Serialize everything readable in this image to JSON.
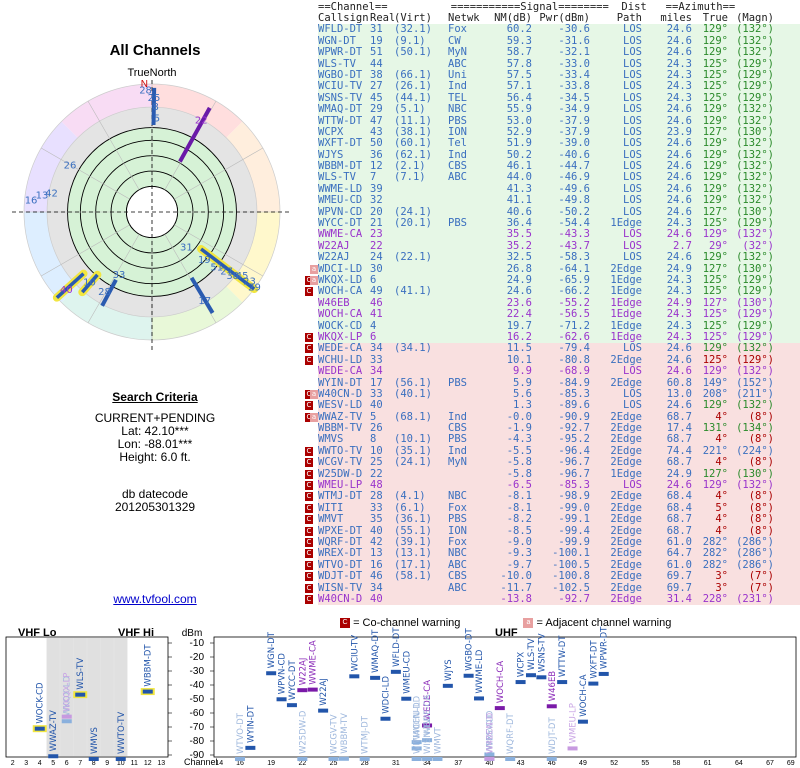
{
  "left": {
    "title": "All Channels",
    "true_north": "TrueNorth",
    "north_letter": "N",
    "criteria_title": "Search Criteria",
    "criteria": [
      "CURRENT+PENDING",
      "Lat: 42.10***",
      "Lon: -88.01***",
      "Height: 6.0 ft."
    ],
    "db": [
      "db datecode",
      "201205301329"
    ],
    "link": "www.tvfool.com"
  },
  "table": {
    "header1": "==Channel==          ===========Signal========  Dist   ==Azimuth==",
    "header2": [
      "Callsign",
      "Real",
      "(Virt)",
      "Netwk",
      "NM(dB)",
      "Pwr(dBm)",
      "Path",
      "miles",
      "True",
      "(Magn)"
    ],
    "rows": [
      [
        "WFLD-DT",
        "31",
        "(32.1)",
        "Fox",
        "60.2",
        "-30.6",
        "LOS",
        "24.6",
        "129°",
        "(132°)",
        "g",
        ""
      ],
      [
        "WGN-DT",
        "19",
        "(9.1)",
        "CW",
        "59.3",
        "-31.6",
        "LOS",
        "24.6",
        "129°",
        "(132°)",
        "g",
        ""
      ],
      [
        "WPWR-DT",
        "51",
        "(50.1)",
        "MyN",
        "58.7",
        "-32.1",
        "LOS",
        "24.6",
        "129°",
        "(132°)",
        "g",
        ""
      ],
      [
        "WLS-TV",
        "44",
        "",
        "ABC",
        "57.8",
        "-33.0",
        "LOS",
        "24.3",
        "125°",
        "(129°)",
        "g",
        ""
      ],
      [
        "WGBO-DT",
        "38",
        "(66.1)",
        "Uni",
        "57.5",
        "-33.4",
        "LOS",
        "24.3",
        "125°",
        "(129°)",
        "g",
        ""
      ],
      [
        "WCIU-TV",
        "27",
        "(26.1)",
        "Ind",
        "57.1",
        "-33.8",
        "LOS",
        "24.3",
        "125°",
        "(129°)",
        "g",
        ""
      ],
      [
        "WSNS-TV",
        "45",
        "(44.1)",
        "TEL",
        "56.4",
        "-34.5",
        "LOS",
        "24.3",
        "125°",
        "(129°)",
        "g",
        ""
      ],
      [
        "WMAQ-DT",
        "29",
        "(5.1)",
        "NBC",
        "55.9",
        "-34.9",
        "LOS",
        "24.6",
        "129°",
        "(132°)",
        "g",
        ""
      ],
      [
        "WTTW-DT",
        "47",
        "(11.1)",
        "PBS",
        "53.0",
        "-37.9",
        "LOS",
        "24.6",
        "129°",
        "(132°)",
        "g",
        ""
      ],
      [
        "WCPX",
        "43",
        "(38.1)",
        "ION",
        "52.9",
        "-37.9",
        "LOS",
        "23.9",
        "127°",
        "(130°)",
        "g",
        ""
      ],
      [
        "WXFT-DT",
        "50",
        "(60.1)",
        "Tel",
        "51.9",
        "-39.0",
        "LOS",
        "24.6",
        "129°",
        "(132°)",
        "g",
        ""
      ],
      [
        "WJYS",
        "36",
        "(62.1)",
        "Ind",
        "50.2",
        "-40.6",
        "LOS",
        "24.6",
        "129°",
        "(132°)",
        "g",
        ""
      ],
      [
        "WBBM-DT",
        "12",
        "(2.1)",
        "CBS",
        "46.1",
        "-44.7",
        "LOS",
        "24.6",
        "129°",
        "(132°)",
        "g",
        ""
      ],
      [
        "WLS-TV",
        "7",
        "(7.1)",
        "ABC",
        "44.0",
        "-46.9",
        "LOS",
        "24.6",
        "129°",
        "(132°)",
        "g",
        ""
      ],
      [
        "WWME-LD",
        "39",
        "",
        "",
        "41.3",
        "-49.6",
        "LOS",
        "24.6",
        "129°",
        "(132°)",
        "g",
        ""
      ],
      [
        "WMEU-CD",
        "32",
        "",
        "",
        "41.1",
        "-49.8",
        "LOS",
        "24.6",
        "129°",
        "(132°)",
        "g",
        ""
      ],
      [
        "WPVN-CD",
        "20",
        "(24.1)",
        "",
        "40.6",
        "-50.2",
        "LOS",
        "24.6",
        "127°",
        "(130°)",
        "g",
        ""
      ],
      [
        "WYCC-DT",
        "21",
        "(20.1)",
        "PBS",
        "36.4",
        "-54.4",
        "1Edge",
        "24.3",
        "125°",
        "(129°)",
        "g",
        ""
      ],
      [
        "WWME-CA",
        "23",
        "",
        "",
        "35.5",
        "-43.3",
        "LOS",
        "24.6",
        "129°",
        "(132°)",
        "p",
        ""
      ],
      [
        "W22AJ",
        "22",
        "",
        "",
        "35.2",
        "-43.7",
        "LOS",
        "2.7",
        "29°",
        "(32°)",
        "p",
        ""
      ],
      [
        "W22AJ",
        "24",
        "(22.1)",
        "",
        "32.5",
        "-58.3",
        "LOS",
        "24.6",
        "129°",
        "(132°)",
        "g",
        ""
      ],
      [
        "WDCI-LD",
        "30",
        "",
        "",
        "26.8",
        "-64.1",
        "2Edge",
        "24.9",
        "127°",
        "(130°)",
        "g",
        "a"
      ],
      [
        "WKQX-LD",
        "6",
        "",
        "",
        "24.9",
        "-65.9",
        "1Edge",
        "24.3",
        "125°",
        "(129°)",
        "g",
        "ac"
      ],
      [
        "WOCH-CA",
        "49",
        "(41.1)",
        "",
        "24.6",
        "-66.2",
        "1Edge",
        "24.3",
        "125°",
        "(129°)",
        "g",
        "c"
      ],
      [
        "W46EB",
        "46",
        "",
        "",
        "23.6",
        "-55.2",
        "1Edge",
        "24.9",
        "127°",
        "(130°)",
        "p",
        ""
      ],
      [
        "WOCH-CA",
        "41",
        "",
        "",
        "22.4",
        "-56.5",
        "1Edge",
        "24.3",
        "125°",
        "(129°)",
        "p",
        ""
      ],
      [
        "WOCK-CD",
        "4",
        "",
        "",
        "19.7",
        "-71.2",
        "1Edge",
        "24.3",
        "125°",
        "(129°)",
        "g",
        ""
      ],
      [
        "WKQX-LP",
        "6",
        "",
        "",
        "16.2",
        "-62.6",
        "1Edge",
        "24.3",
        "125°",
        "(129°)",
        "p",
        "c"
      ],
      [
        "WEDE-CA",
        "34",
        "(34.1)",
        "",
        "11.5",
        "-79.4",
        "LOS",
        "24.6",
        "129°",
        "(132°)",
        "r",
        "c"
      ],
      [
        "WCHU-LD",
        "33",
        "",
        "",
        "10.1",
        "-80.8",
        "2Edge",
        "24.6",
        "125°",
        "(129°)",
        "r",
        "c"
      ],
      [
        "WEDE-CA",
        "34",
        "",
        "",
        "9.9",
        "-68.9",
        "LOS",
        "24.6",
        "129°",
        "(132°)",
        "rp",
        ""
      ],
      [
        "WYIN-DT",
        "17",
        "(56.1)",
        "PBS",
        "5.9",
        "-84.9",
        "2Edge",
        "60.8",
        "149°",
        "(152°)",
        "r",
        ""
      ],
      [
        "W40CN-D",
        "33",
        "(40.1)",
        "",
        "5.6",
        "-85.3",
        "LOS",
        "13.0",
        "208°",
        "(211°)",
        "r",
        "ac"
      ],
      [
        "WESV-LD",
        "40",
        "",
        "",
        "1.3",
        "-89.6",
        "LOS",
        "24.6",
        "129°",
        "(132°)",
        "r",
        "c"
      ],
      [
        "WWAZ-TV",
        "5",
        "(68.1)",
        "Ind",
        "-0.0",
        "-90.9",
        "2Edge",
        "68.7",
        "4°",
        "(8°)",
        "r",
        "ac"
      ],
      [
        "WBBM-TV",
        "26",
        "",
        "CBS",
        "-1.9",
        "-92.7",
        "2Edge",
        "17.4",
        "131°",
        "(134°)",
        "r",
        ""
      ],
      [
        "WMVS",
        "8",
        "(10.1)",
        "PBS",
        "-4.3",
        "-95.2",
        "2Edge",
        "68.7",
        "4°",
        "(8°)",
        "r",
        ""
      ],
      [
        "WWTO-TV",
        "10",
        "(35.1)",
        "Ind",
        "-5.5",
        "-96.4",
        "2Edge",
        "74.4",
        "221°",
        "(224°)",
        "r",
        "c"
      ],
      [
        "WCGV-TV",
        "25",
        "(24.1)",
        "MyN",
        "-5.8",
        "-96.7",
        "2Edge",
        "68.7",
        "4°",
        "(8°)",
        "r",
        "c"
      ],
      [
        "W25DW-D",
        "22",
        "",
        "",
        "-5.8",
        "-96.7",
        "1Edge",
        "24.9",
        "127°",
        "(130°)",
        "r",
        "c"
      ],
      [
        "WMEU-LP",
        "48",
        "",
        "",
        "-6.5",
        "-85.3",
        "LOS",
        "24.6",
        "129°",
        "(132°)",
        "rp",
        "c"
      ],
      [
        "WTMJ-DT",
        "28",
        "(4.1)",
        "NBC",
        "-8.1",
        "-98.9",
        "2Edge",
        "68.4",
        "4°",
        "(8°)",
        "r",
        "c"
      ],
      [
        "WITI",
        "33",
        "(6.1)",
        "Fox",
        "-8.1",
        "-99.0",
        "2Edge",
        "68.4",
        "5°",
        "(8°)",
        "r",
        "c"
      ],
      [
        "WMVT",
        "35",
        "(36.1)",
        "PBS",
        "-8.2",
        "-99.1",
        "2Edge",
        "68.7",
        "4°",
        "(8°)",
        "r",
        "c"
      ],
      [
        "WPXE-DT",
        "40",
        "(55.1)",
        "ION",
        "-8.5",
        "-99.4",
        "2Edge",
        "68.7",
        "4°",
        "(8°)",
        "r",
        "c"
      ],
      [
        "WQRF-DT",
        "42",
        "(39.1)",
        "Fox",
        "-9.0",
        "-99.9",
        "2Edge",
        "61.0",
        "282°",
        "(286°)",
        "r",
        "c"
      ],
      [
        "WREX-DT",
        "13",
        "(13.1)",
        "NBC",
        "-9.3",
        "-100.1",
        "2Edge",
        "64.7",
        "282°",
        "(286°)",
        "r",
        "c"
      ],
      [
        "WTVO-DT",
        "16",
        "(17.1)",
        "ABC",
        "-9.7",
        "-100.5",
        "2Edge",
        "61.0",
        "282°",
        "(286°)",
        "r",
        "c"
      ],
      [
        "WDJT-DT",
        "46",
        "(58.1)",
        "CBS",
        "-10.0",
        "-100.8",
        "2Edge",
        "69.7",
        "3°",
        "(7°)",
        "r",
        "c"
      ],
      [
        "WISN-TV",
        "34",
        "",
        "ABC",
        "-11.7",
        "-102.5",
        "2Edge",
        "69.7",
        "3°",
        "(7°)",
        "r",
        "c"
      ],
      [
        "W40CN-D",
        "40",
        "",
        "",
        "-13.8",
        "-92.7",
        "2Edge",
        "31.4",
        "228°",
        "(231°)",
        "rp",
        "c"
      ]
    ]
  },
  "legend": {
    "cochannel": "= Co-channel warning",
    "adjacent": "= Adjacent channel warning",
    "c_letter": "C",
    "a_letter": "a"
  },
  "colors": {
    "green_row": "#e6f7e6",
    "red_row": "#f9e0e0",
    "blue_text": "#3a6fbf",
    "purple_text": "#9933cc",
    "dark_red": "#aa0000"
  },
  "chart_data": {
    "type": "scatter",
    "panels": [
      "VHF Lo",
      "VHF Hi",
      "UHF"
    ],
    "y_unit": "dBm",
    "ylim": [
      -90,
      -10
    ],
    "y_ticks": [
      -10,
      -20,
      -30,
      -40,
      -50,
      -60,
      -70,
      -80,
      -90
    ],
    "vhf_ticks": [
      "2",
      "3",
      "4",
      "5",
      "6",
      "7",
      "8",
      "9",
      "10",
      "11",
      "12",
      "13"
    ],
    "uhf_ticks": [
      "14",
      "16",
      "19",
      "22",
      "25",
      "28",
      "31",
      "34",
      "37",
      "40",
      "43",
      "46",
      "49",
      "52",
      "55",
      "58",
      "61",
      "64",
      "67",
      "69"
    ],
    "channel_axis_label": "Channel",
    "stations": [
      {
        "name": "WOCK-CD",
        "ch": 4,
        "dbm": -71.2,
        "c": "b"
      },
      {
        "name": "WWAZ-TV",
        "ch": 5,
        "dbm": -90.9,
        "c": "b"
      },
      {
        "name": "WKQX-LD",
        "ch": 6,
        "dbm": -65.9,
        "c": "lb"
      },
      {
        "name": "WKQX-LP",
        "ch": 6,
        "dbm": -62.6,
        "c": "lp"
      },
      {
        "name": "WLS-TV",
        "ch": 7,
        "dbm": -46.9,
        "c": "b"
      },
      {
        "name": "WMVS",
        "ch": 8,
        "dbm": -95.2,
        "c": "b"
      },
      {
        "name": "WWTO-TV",
        "ch": 10,
        "dbm": -96.4,
        "c": "b"
      },
      {
        "name": "WBBM-DT",
        "ch": 12,
        "dbm": -44.7,
        "c": "b"
      },
      {
        "name": "WTVO-DT",
        "ch": 16,
        "dbm": -100.5,
        "c": "lb"
      },
      {
        "name": "WYIN-DT",
        "ch": 17,
        "dbm": -84.9,
        "c": "b"
      },
      {
        "name": "WGN-DT",
        "ch": 19,
        "dbm": -31.6,
        "c": "b"
      },
      {
        "name": "WPVN-CD",
        "ch": 20,
        "dbm": -50.2,
        "c": "b"
      },
      {
        "name": "WYCC-DT",
        "ch": 21,
        "dbm": -54.4,
        "c": "b"
      },
      {
        "name": "W22AJ",
        "ch": 22,
        "dbm": -43.7,
        "c": "p"
      },
      {
        "name": "W25DW-D",
        "ch": 22,
        "dbm": -96.7,
        "c": "lb"
      },
      {
        "name": "WWME-CA",
        "ch": 23,
        "dbm": -43.3,
        "c": "p"
      },
      {
        "name": "W22AJ",
        "ch": 24,
        "dbm": -58.3,
        "c": "b"
      },
      {
        "name": "WCGV-TV",
        "ch": 25,
        "dbm": -96.7,
        "c": "lb"
      },
      {
        "name": "WBBM-TV",
        "ch": 26,
        "dbm": -92.7,
        "c": "lb"
      },
      {
        "name": "WCIU-TV",
        "ch": 27,
        "dbm": -33.8,
        "c": "b"
      },
      {
        "name": "WTMJ-DT",
        "ch": 28,
        "dbm": -98.9,
        "c": "lb"
      },
      {
        "name": "WMAQ-DT",
        "ch": 29,
        "dbm": -34.9,
        "c": "b"
      },
      {
        "name": "WDCI-LD",
        "ch": 30,
        "dbm": -64.1,
        "c": "b"
      },
      {
        "name": "WFLD-DT",
        "ch": 31,
        "dbm": -30.6,
        "c": "b"
      },
      {
        "name": "WMEU-CD",
        "ch": 32,
        "dbm": -49.8,
        "c": "b"
      },
      {
        "name": "WCHU-LD",
        "ch": 33,
        "dbm": -80.8,
        "c": "lb"
      },
      {
        "name": "W40CN-D",
        "ch": 33,
        "dbm": -85.3,
        "c": "lb"
      },
      {
        "name": "WITI",
        "ch": 33,
        "dbm": -99.0,
        "c": "lb"
      },
      {
        "name": "WEDE-CA",
        "ch": 34,
        "dbm": -68.9,
        "c": "p"
      },
      {
        "name": "WEDE-CA",
        "ch": 34,
        "dbm": -79.4,
        "c": "lb"
      },
      {
        "name": "WISN-TV",
        "ch": 34,
        "dbm": -102.5,
        "c": "lb"
      },
      {
        "name": "WMVT",
        "ch": 35,
        "dbm": -99.1,
        "c": "lb"
      },
      {
        "name": "WJYS",
        "ch": 36,
        "dbm": -40.6,
        "c": "b"
      },
      {
        "name": "WGBO-DT",
        "ch": 38,
        "dbm": -33.4,
        "c": "b"
      },
      {
        "name": "WWME-LD",
        "ch": 39,
        "dbm": -49.6,
        "c": "b"
      },
      {
        "name": "WESV-LD",
        "ch": 40,
        "dbm": -89.6,
        "c": "lb"
      },
      {
        "name": "WPXE-DT",
        "ch": 40,
        "dbm": -99.4,
        "c": "lb"
      },
      {
        "name": "W40CN-D",
        "ch": 40,
        "dbm": -92.7,
        "c": "lp"
      },
      {
        "name": "WOCH-CA",
        "ch": 41,
        "dbm": -56.5,
        "c": "p"
      },
      {
        "name": "WQRF-DT",
        "ch": 42,
        "dbm": -99.9,
        "c": "lb"
      },
      {
        "name": "WCPX",
        "ch": 43,
        "dbm": -37.9,
        "c": "b"
      },
      {
        "name": "WLS-TV",
        "ch": 44,
        "dbm": -33.0,
        "c": "b"
      },
      {
        "name": "WSNS-TV",
        "ch": 45,
        "dbm": -34.5,
        "c": "b"
      },
      {
        "name": "W46EB",
        "ch": 46,
        "dbm": -55.2,
        "c": "p"
      },
      {
        "name": "WDJT-DT",
        "ch": 46,
        "dbm": -100.8,
        "c": "lb"
      },
      {
        "name": "WTTW-DT",
        "ch": 47,
        "dbm": -37.9,
        "c": "b"
      },
      {
        "name": "WMEU-LP",
        "ch": 48,
        "dbm": -85.3,
        "c": "lp"
      },
      {
        "name": "WOCH-CA",
        "ch": 49,
        "dbm": -66.2,
        "c": "b"
      },
      {
        "name": "WXFT-DT",
        "ch": 50,
        "dbm": -39.0,
        "c": "b"
      },
      {
        "name": "WPWR-DT",
        "ch": 51,
        "dbm": -32.1,
        "c": "b"
      }
    ],
    "radar": {
      "type": "polar",
      "rings": 5,
      "labels": [
        {
          "text": "28",
          "az": 357,
          "r": 0.96
        },
        {
          "text": "25",
          "az": 1,
          "r": 0.9
        },
        {
          "text": "8",
          "az": 2,
          "r": 0.83
        },
        {
          "text": "5",
          "az": 3,
          "r": 0.74
        },
        {
          "text": "22",
          "az": 28,
          "r": 0.82
        },
        {
          "text": "26",
          "az": 300,
          "r": 0.74
        },
        {
          "text": "16",
          "az": 276,
          "r": 0.95
        },
        {
          "text": "13",
          "az": 279,
          "r": 0.87
        },
        {
          "text": "42",
          "az": 281,
          "r": 0.8
        },
        {
          "text": "31",
          "az": 135,
          "r": 0.38
        },
        {
          "text": "19",
          "az": 132,
          "r": 0.55
        },
        {
          "text": "51",
          "az": 130,
          "r": 0.66
        },
        {
          "text": "27",
          "az": 128,
          "r": 0.74
        },
        {
          "text": "38",
          "az": 128,
          "r": 0.8
        },
        {
          "text": "45",
          "az": 125,
          "r": 0.86
        },
        {
          "text": "23",
          "az": 125,
          "r": 0.93
        },
        {
          "text": "29",
          "az": 126,
          "r": 0.99
        },
        {
          "text": "17",
          "az": 149,
          "r": 0.8
        },
        {
          "text": "40",
          "az": 228,
          "r": 0.9
        },
        {
          "text": "10",
          "az": 222,
          "r": 0.73
        },
        {
          "text": "33",
          "az": 208,
          "r": 0.55
        },
        {
          "text": "28",
          "az": 211,
          "r": 0.72
        }
      ],
      "bars": [
        {
          "az": 1,
          "r0": 0.68,
          "r1": 0.97,
          "c": "blue"
        },
        {
          "az": 29,
          "r0": 0.45,
          "r1": 0.93,
          "c": "purple"
        },
        {
          "az": 127,
          "r0": 0.48,
          "r1": 1.0,
          "c": "yellow"
        },
        {
          "az": 149,
          "r0": 0.6,
          "r1": 0.92,
          "c": "blue"
        },
        {
          "az": 228,
          "r0": 0.72,
          "r1": 1.0,
          "c": "yellow"
        },
        {
          "az": 221,
          "r0": 0.65,
          "r1": 0.83,
          "c": "yellow"
        },
        {
          "az": 208,
          "r0": 0.6,
          "r1": 0.83,
          "c": "blue"
        }
      ]
    }
  }
}
